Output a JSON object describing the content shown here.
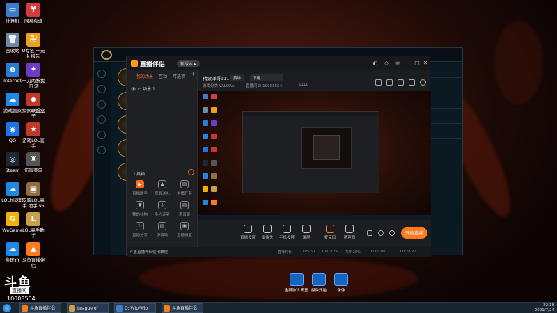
{
  "desktop_icons": [
    {
      "label": "计算机",
      "color": "#3d7cc9",
      "glyph": "▭"
    },
    {
      "label": "网易有道",
      "color": "#d23c3c",
      "glyph": "¥"
    },
    {
      "label": "回收站",
      "color": "#6f8aa3",
      "glyph": "🗑"
    },
    {
      "label": "U专链 一元k 报告",
      "color": "#e8a21c",
      "glyph": "卍"
    },
    {
      "label": "Internet",
      "color": "#2b7bd6",
      "glyph": "e"
    },
    {
      "label": "一刀两断我们 游",
      "color": "#6a3cc8",
      "glyph": "✦"
    },
    {
      "label": "游戏管家",
      "color": "#1e88e5",
      "glyph": "☁"
    },
    {
      "label": "探索联盟盒子",
      "color": "#c0392b",
      "glyph": "◆"
    },
    {
      "label": "QQ",
      "color": "#1a73e8",
      "glyph": "◉"
    },
    {
      "label": "游戏LOL高手",
      "color": "#c0392b",
      "glyph": "★"
    },
    {
      "label": "Steam",
      "color": "#1b2838",
      "glyph": "◎"
    },
    {
      "label": "伤害菜单",
      "color": "#555555",
      "glyph": "♜"
    },
    {
      "label": "LOL加速器",
      "color": "#1e88e5",
      "glyph": "☁"
    },
    {
      "label": "安装LOL高手 助手 v5",
      "color": "#8d6e3c",
      "glyph": "▣"
    },
    {
      "label": "WeGame",
      "color": "#f0b400",
      "glyph": "G"
    },
    {
      "label": "LOL高手助手",
      "color": "#c8a04a",
      "glyph": "L"
    },
    {
      "label": "多玩YY",
      "color": "#1e88e5",
      "glyph": "☁"
    },
    {
      "label": "斗鱼直播伴侣",
      "color": "#ff7a1a",
      "glyph": "▲"
    }
  ],
  "zb": {
    "app_name": "直播伴侣",
    "version_badge": "新版本 ▸",
    "tabs": [
      "我的场景",
      "互动",
      "可选项"
    ],
    "scene_name": "场景 1",
    "tools_header": "工具箱",
    "tools": [
      {
        "label": "直播助手",
        "glyph": "▶",
        "hot": true
      },
      {
        "label": "观看送礼",
        "glyph": "♟",
        "hot": false
      },
      {
        "label": "主播任务",
        "glyph": "▤",
        "hot": false
      },
      {
        "label": "我的礼物",
        "glyph": "♥",
        "hot": false
      },
      {
        "label": "多人连麦",
        "glyph": "⇩",
        "hot": false
      },
      {
        "label": "语音聊",
        "glyph": "▤",
        "hot": false
      },
      {
        "label": "直播分享",
        "glyph": "↻",
        "hot": false
      },
      {
        "label": "弹幕助",
        "glyph": "▤",
        "hot": false
      },
      {
        "label": "直播设置",
        "glyph": "▣",
        "hot": false
      }
    ],
    "bottom_note": "斗鱼直播伴侣使用教程",
    "room_title": "精致洋哥111",
    "category_field": "英雄",
    "tag_field": "下组",
    "meta_1": "游戏分类  VALORA",
    "meta_2": "直播间ID  10003554",
    "meta_3": "1110",
    "actions": [
      "直播设置",
      "摄像头",
      "手机投屏",
      "录屏",
      "麦克风",
      "扬声器"
    ],
    "start_button": "开始直播",
    "status": [
      "直播时长",
      "FPS:60",
      "CPU:12%",
      "内存:28%",
      "00:00:00",
      "00:28:22"
    ],
    "accent": "#ff7a1a"
  },
  "quick_buttons": [
    "全屏游戏 截图",
    "摄像开始",
    "录像"
  ],
  "watermark": {
    "logo": "斗鱼",
    "sub": "直播间",
    "room": "10003554"
  },
  "taskbar": {
    "items": [
      {
        "label": "斗鱼直播伴侣",
        "color": "#ff7a1a"
      },
      {
        "label": "League of Lege",
        "color": "#c8a04a"
      },
      {
        "label": "D:/Wip/Wip",
        "color": "#3d7cc9"
      },
      {
        "label": "斗鱼直播伴侣",
        "color": "#ff7a1a"
      }
    ],
    "time": "22:18",
    "date": "2021/7/24"
  }
}
